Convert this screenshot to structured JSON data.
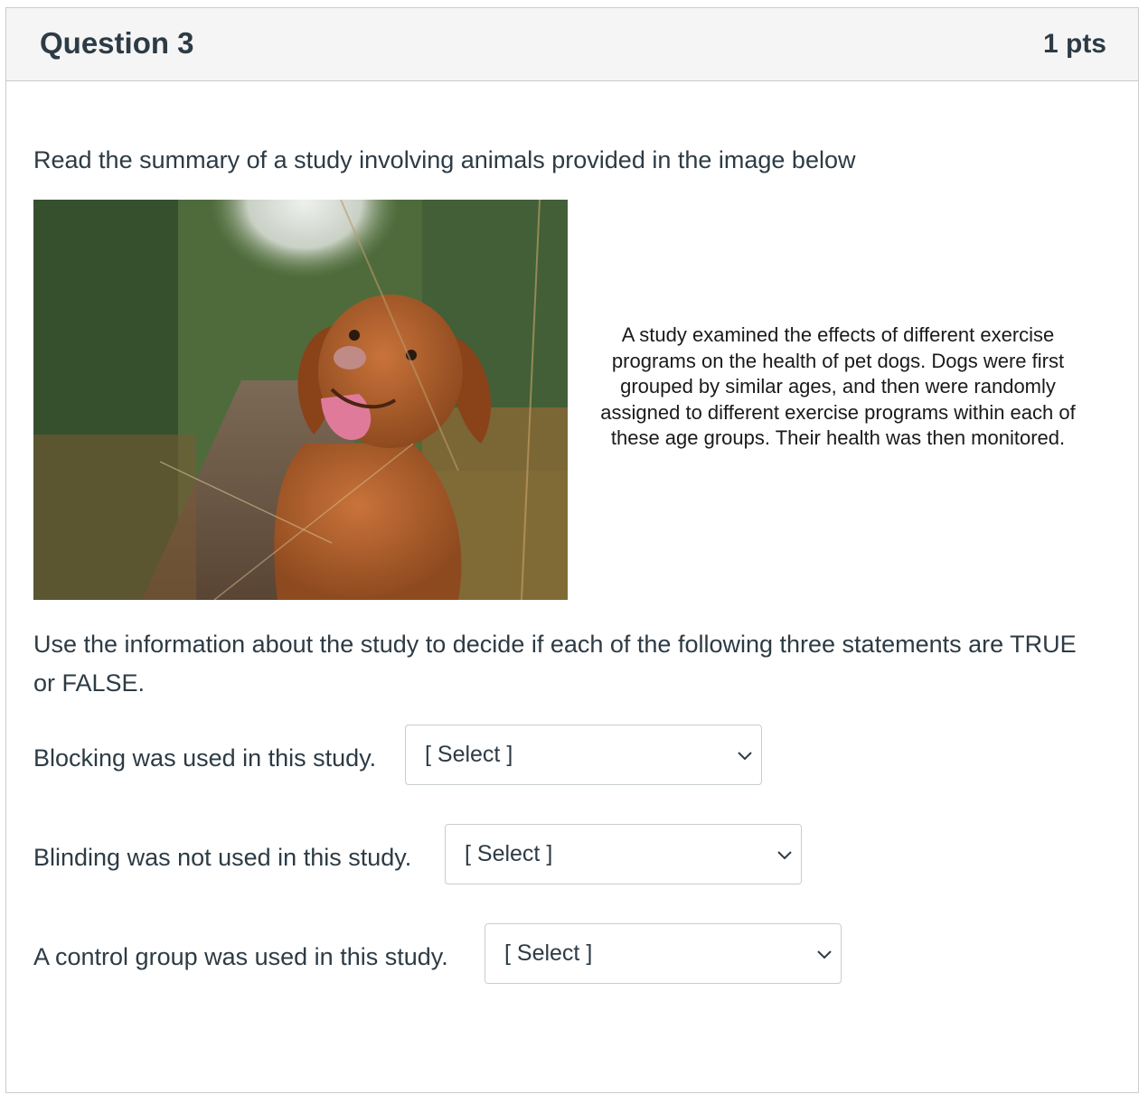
{
  "question": {
    "title": "Question 3",
    "points": "1 pts"
  },
  "intro_text": "Read the summary of a study involving animals provided in the image below",
  "study_image": {
    "summary": "A study examined the effects of different exercise programs on the health of pet dogs. Dogs were first grouped by similar ages, and then were randomly assigned to different exercise programs within each of these age groups. Their health was then monitored."
  },
  "instructions": "Use the information about the study to decide if each of the following three statements are TRUE or FALSE.",
  "statements": [
    {
      "text": "Blocking was used in this study.",
      "selected": "[ Select ]"
    },
    {
      "text": "Blinding was not used in this study.",
      "selected": "[ Select ]"
    },
    {
      "text": "A control group was used in this study.",
      "selected": "[ Select ]"
    }
  ],
  "icons": {
    "dropdown": "chevron-down-icon"
  },
  "colors": {
    "text": "#2d3b45",
    "header_bg": "#f5f5f5",
    "border": "#c7cdd1"
  }
}
